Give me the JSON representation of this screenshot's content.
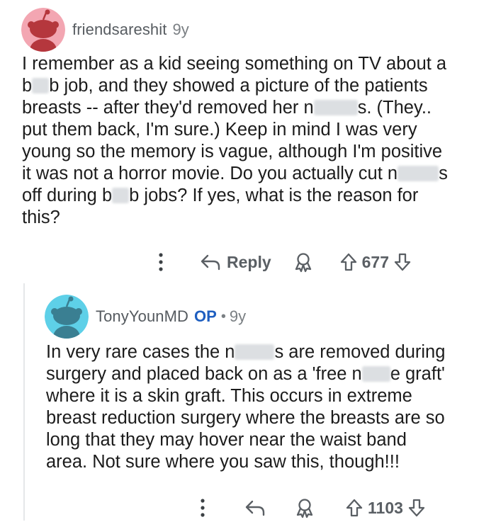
{
  "colors": {
    "avatar1_bg": "#f3a6b2",
    "avatar2_bg": "#5ed0e8",
    "op_color": "#1f5fc0"
  },
  "comments": [
    {
      "username": "friendsareshit",
      "age": "9y",
      "lines": [
        [
          "I remember as a kid seeing something on TV about a"
        ],
        [
          "b",
          "BLUR:24",
          "b job, and they showed a picture of the patients"
        ],
        [
          "breasts -- after they'd removed her n",
          "BLUR:62",
          "s. (They.."
        ],
        [
          "put them back, I'm sure.) Keep in mind I was very"
        ],
        [
          "young so the memory is vague, although I'm positive"
        ],
        [
          "it was not a horror movie. Do you actually cut n",
          "BLUR:58",
          "s"
        ],
        [
          "off during b",
          "BLUR:24",
          "b jobs? If yes, what is the reason for"
        ],
        [
          "this?"
        ]
      ],
      "actions": {
        "more_icon": "more-vertical-icon",
        "reply_label": "Reply",
        "award_icon": "award-icon",
        "vote_count": "677"
      }
    },
    {
      "username": "TonyYounMD",
      "op_label": "OP",
      "separator": "•",
      "age": "9y",
      "lines": [
        [
          "In very rare cases the n",
          "BLUR:56",
          "s are removed during"
        ],
        [
          "surgery and placed back on as a 'free n",
          "BLUR:40",
          "e graft'"
        ],
        [
          "where it is a skin graft. This occurs in extreme"
        ],
        [
          "breast reduction surgery where the breasts are so"
        ],
        [
          "long that they may hover near the waist band"
        ],
        [
          "area. Not sure where you saw this, though!!!"
        ]
      ],
      "actions": {
        "more_icon": "more-vertical-icon",
        "reply_icon": "reply-arrow-icon",
        "award_icon": "award-icon",
        "vote_count": "1103"
      }
    }
  ]
}
